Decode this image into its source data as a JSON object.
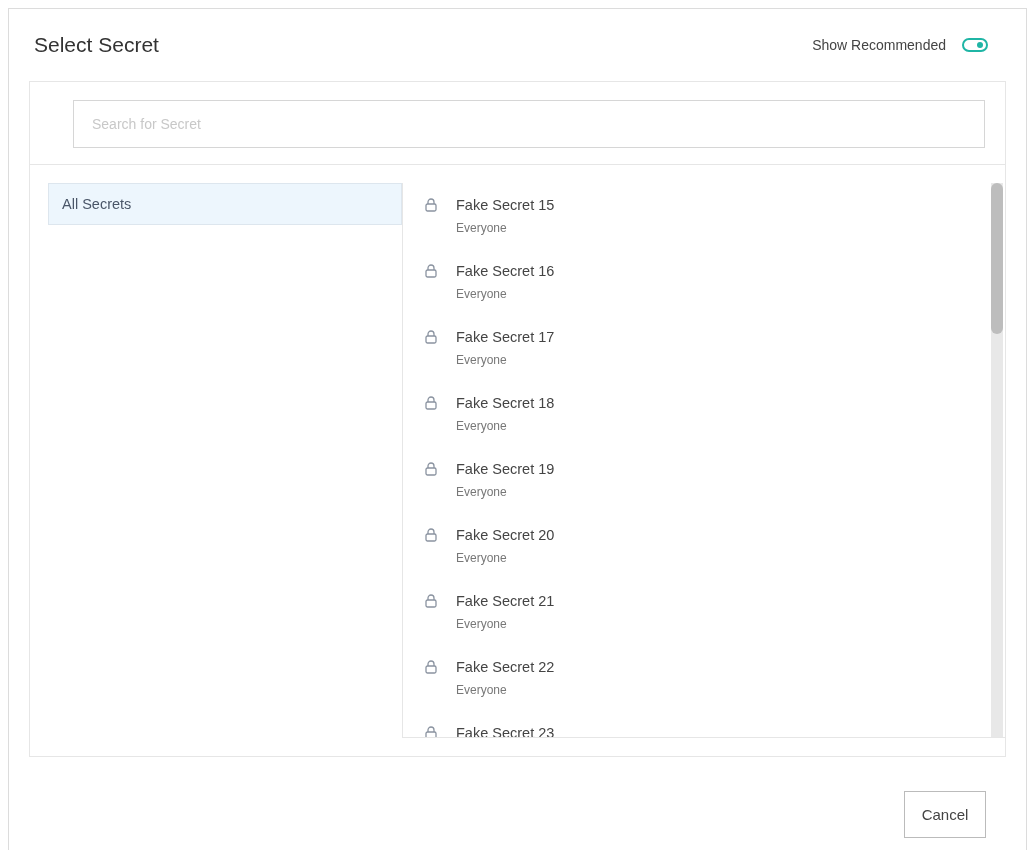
{
  "dialog": {
    "title": "Select Secret"
  },
  "show_recommended": {
    "label": "Show Recommended",
    "on": true
  },
  "search": {
    "placeholder": "Search for Secret"
  },
  "folders": [
    {
      "label": "All Secrets",
      "selected": true
    }
  ],
  "secrets": [
    {
      "name": "Fake Secret 15",
      "owner": "Everyone"
    },
    {
      "name": "Fake Secret 16",
      "owner": "Everyone"
    },
    {
      "name": "Fake Secret 17",
      "owner": "Everyone"
    },
    {
      "name": "Fake Secret 18",
      "owner": "Everyone"
    },
    {
      "name": "Fake Secret 19",
      "owner": "Everyone"
    },
    {
      "name": "Fake Secret 20",
      "owner": "Everyone"
    },
    {
      "name": "Fake Secret 21",
      "owner": "Everyone"
    },
    {
      "name": "Fake Secret 22",
      "owner": "Everyone"
    },
    {
      "name": "Fake Secret 23"
    }
  ],
  "buttons": [
    {
      "label": "Cancel"
    }
  ]
}
